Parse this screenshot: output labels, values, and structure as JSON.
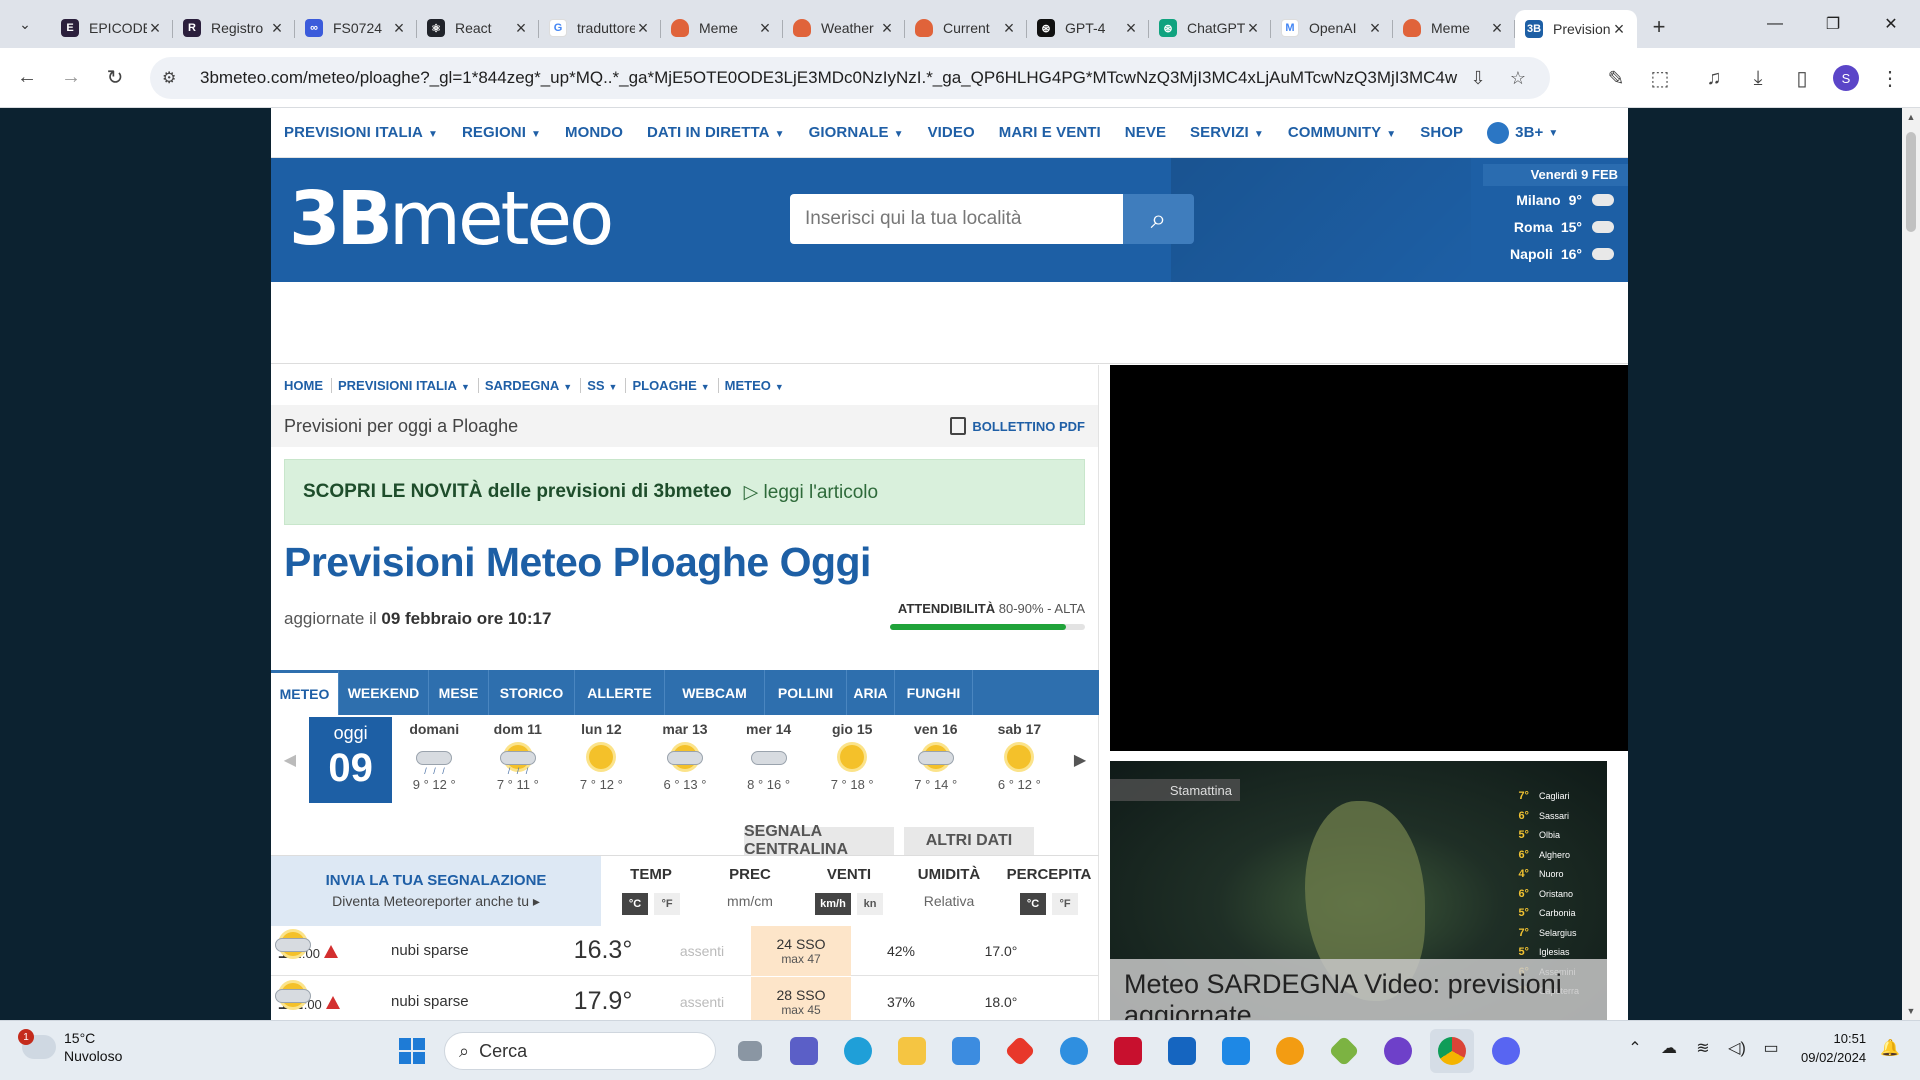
{
  "browser": {
    "tabs": [
      {
        "title": "EPICODE",
        "color": "#2b1f3c",
        "letter": "E"
      },
      {
        "title": "Registro",
        "color": "#2b1f3c",
        "letter": "R"
      },
      {
        "title": "FS0724",
        "color": "#3b5bdb",
        "letter": "∞"
      },
      {
        "title": "React",
        "color": "#20232a",
        "letter": "⚛"
      },
      {
        "title": "traduttore",
        "color": "#ffffff",
        "letter": "G"
      },
      {
        "title": "Meme",
        "color": "#e0633a",
        "letter": ""
      },
      {
        "title": "Weather",
        "color": "#e0633a",
        "letter": ""
      },
      {
        "title": "Current",
        "color": "#e0633a",
        "letter": ""
      },
      {
        "title": "GPT-4",
        "color": "#111111",
        "letter": "⊛"
      },
      {
        "title": "ChatGPT",
        "color": "#10a37f",
        "letter": "⊛"
      },
      {
        "title": "OpenAI",
        "color": "#ffffff",
        "letter": "M"
      },
      {
        "title": "Meme",
        "color": "#e0633a",
        "letter": ""
      },
      {
        "title": "Previsioni",
        "color": "#1d5fa5",
        "letter": "3B"
      }
    ],
    "url": "3bmeteo.com/meteo/ploaghe?_gl=1*844zeg*_up*MQ..*_ga*MjE5OTE0ODE3LjE3MDc0NzIyNzI.*_ga_QP6HLHG4PG*MTcwNzQ3MjI3MC4xLjAuMTcwNzQ3MjI3MC4wLj...",
    "profile_initial": "S"
  },
  "site": {
    "nav": [
      {
        "label": "PREVISIONI ITALIA",
        "caret": true
      },
      {
        "label": "REGIONI",
        "caret": true
      },
      {
        "label": "MONDO",
        "caret": false
      },
      {
        "label": "DATI IN DIRETTA",
        "caret": true
      },
      {
        "label": "GIORNALE",
        "caret": true
      },
      {
        "label": "VIDEO",
        "caret": false
      },
      {
        "label": "MARI E VENTI",
        "caret": false
      },
      {
        "label": "NEVE",
        "caret": false
      },
      {
        "label": "SERVIZI",
        "caret": true
      },
      {
        "label": "COMMUNITY",
        "caret": true
      },
      {
        "label": "SHOP",
        "caret": false
      }
    ],
    "user_menu": "3B+",
    "logo_a": "3B",
    "logo_b": "meteo",
    "search_placeholder": "Inserisci qui la tua località",
    "header_date": "Venerdì 9 FEB",
    "cities": [
      {
        "name": "Milano",
        "temp": "9°"
      },
      {
        "name": "Roma",
        "temp": "15°"
      },
      {
        "name": "Napoli",
        "temp": "16°"
      }
    ],
    "breadcrumb": [
      {
        "label": "HOME",
        "caret": false
      },
      {
        "label": "PREVISIONI ITALIA",
        "caret": true
      },
      {
        "label": "SARDEGNA",
        "caret": true
      },
      {
        "label": "SS",
        "caret": true
      },
      {
        "label": "PLOAGHE",
        "caret": true
      },
      {
        "label": "METEO",
        "caret": true
      }
    ],
    "subtitle": "Previsioni per oggi a Ploaghe",
    "pdf_label": "BOLLETTINO PDF",
    "promo_bold": "SCOPRI LE NOVITÀ delle previsioni di 3bmeteo",
    "promo_link": "▷ leggi l'articolo",
    "title": "Previsioni Meteo Ploaghe Oggi",
    "updated_prefix": "aggiornate il",
    "updated_value": "09 febbraio ore 10:17",
    "reliability_label": "ATTENDIBILITÀ",
    "reliability_value": "80-90% - ALTA",
    "reliability_level": 0.9,
    "subtabs": [
      "METEO",
      "WEEKEND",
      "MESE",
      "STORICO",
      "ALLERTE",
      "WEBCAM",
      "POLLINI",
      "ARIA",
      "FUNGHI"
    ],
    "today": {
      "label": "oggi",
      "day": "09"
    },
    "days": [
      {
        "label": "domani",
        "temps": "9 ° 12 °",
        "icon": "rain"
      },
      {
        "label": "dom 11",
        "temps": "7 ° 11 °",
        "icon": "sunrain"
      },
      {
        "label": "lun 12",
        "temps": "7 ° 12 °",
        "icon": "sun"
      },
      {
        "label": "mar 13",
        "temps": "6 ° 13 °",
        "icon": "suncloud"
      },
      {
        "label": "mer 14",
        "temps": "8 ° 16 °",
        "icon": "cloud"
      },
      {
        "label": "gio 15",
        "temps": "7 ° 18 °",
        "icon": "sun"
      },
      {
        "label": "ven 16",
        "temps": "7 ° 14 °",
        "icon": "suncloud"
      },
      {
        "label": "sab 17",
        "temps": "6 ° 12 °",
        "icon": "sun"
      }
    ],
    "extra_tabs": [
      "SEGNALA CENTRALINA",
      "ALTRI DATI"
    ],
    "report_title": "INVIA LA TUA SEGNALAZIONE",
    "report_sub": "Diventa Meteoreporter anche tu ▸",
    "columns": {
      "temp": "TEMP",
      "prec": "PREC",
      "prec_unit": "mm/cm",
      "wind": "VENTI",
      "hum": "UMIDITÀ",
      "hum_sub": "Relativa",
      "perc": "PERCEPITA",
      "unit_c": "°C",
      "unit_f": "°F",
      "unit_kmh": "km/h",
      "unit_kn": "kn"
    },
    "hours": [
      {
        "hour": "11",
        "min": ":00",
        "desc": "nubi sparse",
        "temp": "16.3°",
        "prec": "assenti",
        "wind": "24  SSO",
        "wind_max": "max 47",
        "hum": "42%",
        "perc": "17.0°"
      },
      {
        "hour": "12",
        "min": ":00",
        "desc": "nubi sparse",
        "temp": "17.9°",
        "prec": "assenti",
        "wind": "28  SSO",
        "wind_max": "max 45",
        "hum": "37%",
        "perc": "18.0°"
      }
    ],
    "video_tag": "Stamattina",
    "video_caption": "Meteo SARDEGNA Video: previsioni aggiornate",
    "video_list": [
      {
        "t": "7°",
        "c": "Cagliari"
      },
      {
        "t": "6°",
        "c": "Sassari"
      },
      {
        "t": "5°",
        "c": "Olbia"
      },
      {
        "t": "6°",
        "c": "Alghero"
      },
      {
        "t": "4°",
        "c": "Nuoro"
      },
      {
        "t": "6°",
        "c": "Oristano"
      },
      {
        "t": "5°",
        "c": "Carbonia"
      },
      {
        "t": "7°",
        "c": "Selargius"
      },
      {
        "t": "5°",
        "c": "Iglesias"
      },
      {
        "t": "6°",
        "c": "Assemini"
      },
      {
        "t": "7°",
        "c": "Capoterra"
      }
    ]
  },
  "taskbar": {
    "weather_temp": "15°C",
    "weather_desc": "Nuvoloso",
    "weather_badge": "1",
    "search_label": "Cerca",
    "time": "10:51",
    "date": "09/02/2024"
  }
}
